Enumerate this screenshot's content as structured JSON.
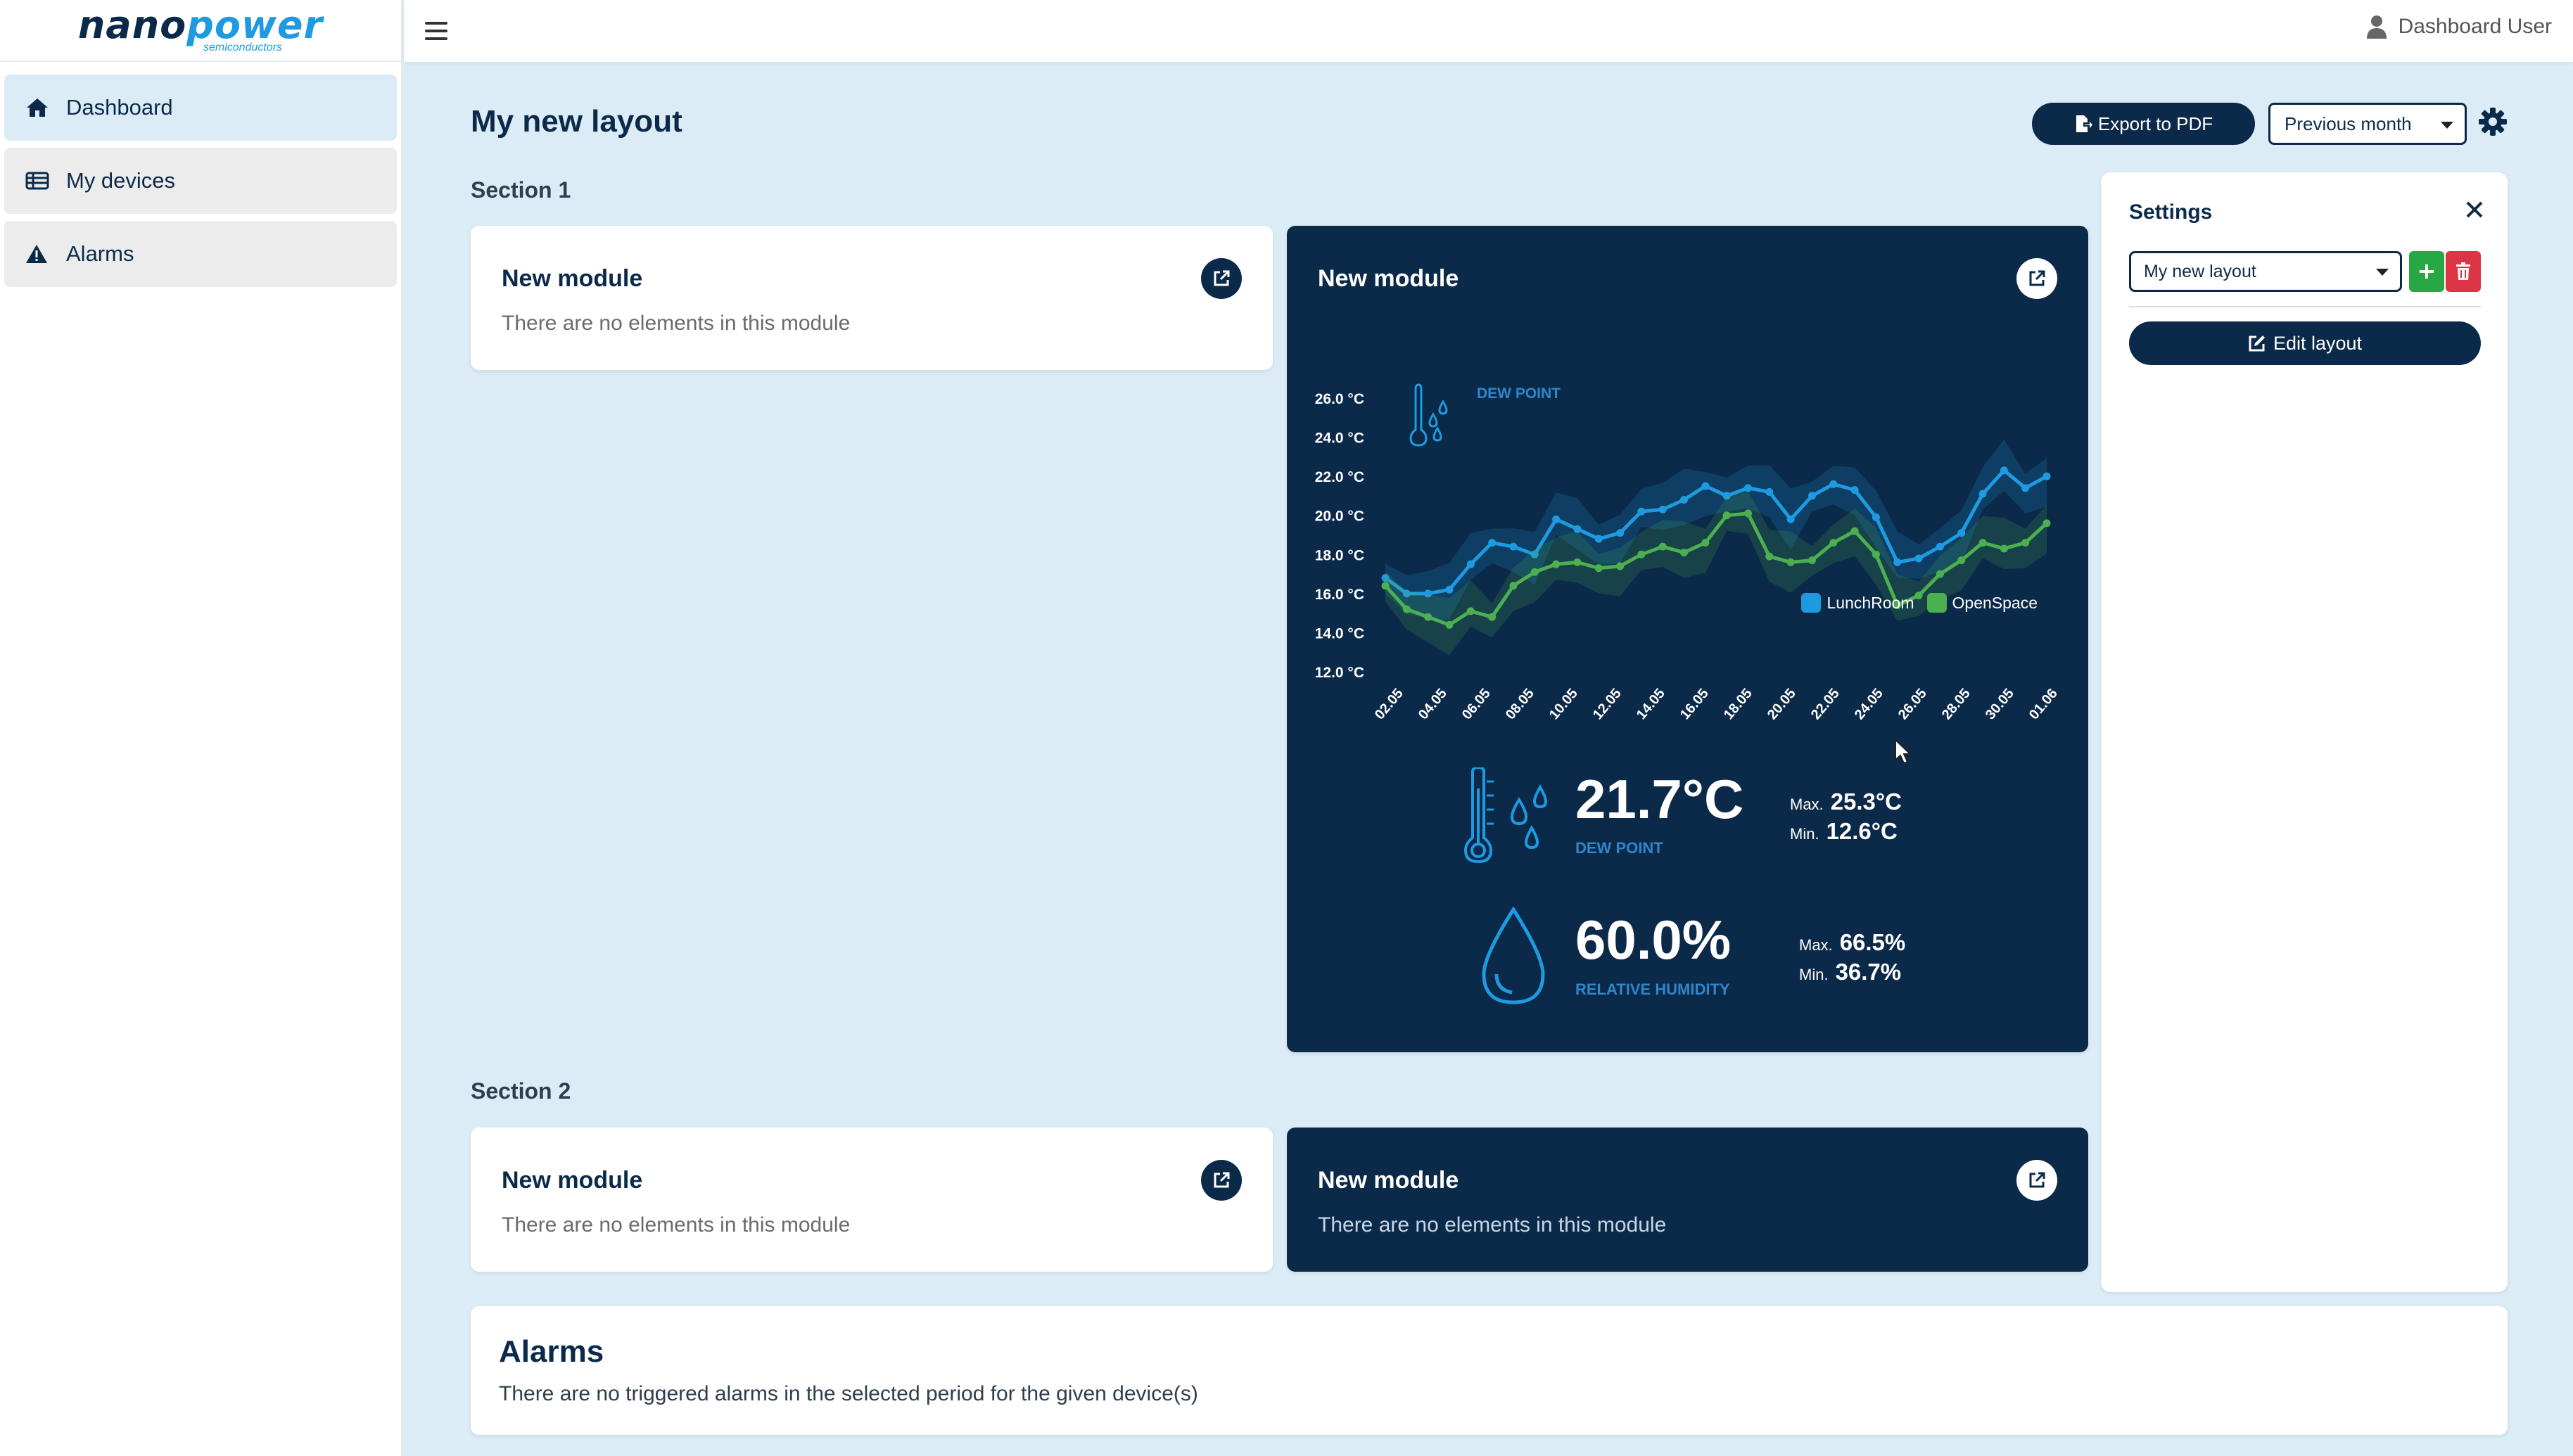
{
  "brand": {
    "name_part1": "nano",
    "name_part2": "power",
    "sub": "semiconductors"
  },
  "sidebar": {
    "items": [
      {
        "label": "Dashboard",
        "icon": "home-icon",
        "active": true
      },
      {
        "label": "My devices",
        "icon": "devices-icon",
        "active": false
      },
      {
        "label": "Alarms",
        "icon": "warning-icon",
        "active": false
      }
    ]
  },
  "topbar": {
    "user_label": "Dashboard User"
  },
  "page": {
    "title": "My new layout",
    "export_label": "Export to PDF",
    "period_value": "Previous month"
  },
  "sections": [
    {
      "label": "Section 1",
      "modules": [
        {
          "title": "New module",
          "empty_text": "There are no elements in this module",
          "theme": "light"
        },
        {
          "title": "New module",
          "theme": "dark"
        }
      ]
    },
    {
      "label": "Section 2",
      "modules": [
        {
          "title": "New module",
          "empty_text": "There are no elements in this module",
          "theme": "light"
        },
        {
          "title": "New module",
          "empty_text": "There are no elements in this module",
          "theme": "dark"
        }
      ]
    }
  ],
  "metrics": {
    "dew_point": {
      "value": "21.7°C",
      "label": "DEW POINT",
      "max_label": "Max.",
      "max": "25.3°C",
      "min_label": "Min.",
      "min": "12.6°C"
    },
    "humidity": {
      "value": "60.0%",
      "label": "RELATIVE HUMIDITY",
      "max_label": "Max.",
      "max": "66.5%",
      "min_label": "Min.",
      "min": "36.7%"
    }
  },
  "settings": {
    "title": "Settings",
    "layout_value": "My new layout",
    "edit_label": "Edit layout"
  },
  "alarms": {
    "title": "Alarms",
    "text": "There are no triggered alarms in the selected period for the given device(s)"
  },
  "colors": {
    "navy": "#0b2a4a",
    "blue": "#1e9be0",
    "green": "#4caf50",
    "bg": "#dcecf6"
  },
  "chart_data": {
    "type": "line",
    "annotation": "DEW POINT",
    "y_ticks": [
      "12.0 °C",
      "14.0 °C",
      "16.0 °C",
      "18.0 °C",
      "20.0 °C",
      "22.0 °C",
      "24.0 °C",
      "26.0 °C"
    ],
    "x_ticks": [
      "02.05",
      "04.05",
      "06.05",
      "08.05",
      "10.05",
      "12.05",
      "14.05",
      "16.05",
      "18.05",
      "20.05",
      "22.05",
      "24.05",
      "26.05",
      "28.05",
      "30.05",
      "01.06"
    ],
    "ylim": [
      12,
      26
    ],
    "grid": false,
    "legend_position": "top-right",
    "series": [
      {
        "name": "LunchRoom",
        "color": "#1e9be0",
        "values": [
          16.8,
          16.0,
          16.0,
          16.2,
          17.5,
          18.6,
          18.4,
          18.0,
          19.8,
          19.3,
          18.8,
          19.1,
          20.2,
          20.3,
          20.8,
          21.5,
          21.0,
          21.4,
          21.2,
          19.8,
          21.0,
          21.6,
          21.3,
          19.9,
          17.6,
          17.8,
          18.4,
          19.1,
          21.1,
          22.3,
          21.4,
          22.0
        ]
      },
      {
        "name": "OpenSpace",
        "color": "#4caf50",
        "values": [
          16.4,
          15.2,
          14.8,
          14.4,
          15.1,
          14.8,
          16.4,
          17.1,
          17.5,
          17.6,
          17.3,
          17.4,
          18.0,
          18.4,
          18.1,
          18.6,
          20.0,
          20.1,
          17.9,
          17.6,
          17.7,
          18.6,
          19.2,
          18.0,
          15.4,
          15.9,
          17.0,
          17.7,
          18.6,
          18.3,
          18.6,
          19.6
        ]
      }
    ]
  }
}
